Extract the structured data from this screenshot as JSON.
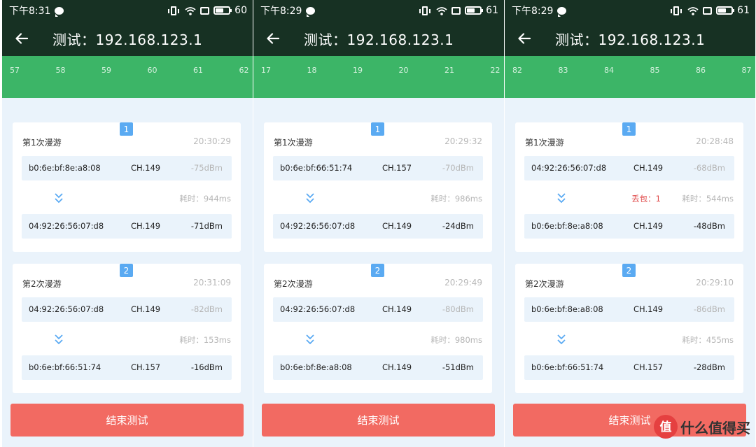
{
  "app": {
    "title": "测试：192.168.123.1",
    "end_button_label": "结束测试",
    "latency_prefix": "耗时：",
    "loss_prefix": "丢包："
  },
  "colors": {
    "appbar_bg": "#173123",
    "ruler_bg": "#3cb567",
    "page_bg": "#eaf3fb",
    "badge_bg": "#5aaaf2",
    "end_button_bg": "#f26a62",
    "loss_text": "#e04b4b"
  },
  "icons": {
    "back": "back-arrow-icon",
    "message": "chat-bubble-icon",
    "vibrate": "vibrate-icon",
    "wifi": "wifi-icon",
    "screen": "screen-icon",
    "battery": "battery-icon",
    "transition": "double-chevron-down-icon"
  },
  "screens": [
    {
      "status": {
        "time": "下午8:31",
        "battery": "60"
      },
      "ruler": [
        "57",
        "58",
        "59",
        "60",
        "61",
        "62"
      ],
      "roams": [
        {
          "badge": "1",
          "title": "第1次漫游",
          "time": "20:30:29",
          "from": {
            "mac": "b0:6e:bf:8e:a8:08",
            "channel": "CH.149",
            "signal": "-75dBm"
          },
          "loss": "",
          "latency": "944ms",
          "to": {
            "mac": "04:92:26:56:07:d8",
            "channel": "CH.149",
            "signal": "-71dBm"
          }
        },
        {
          "badge": "2",
          "title": "第2次漫游",
          "time": "20:31:09",
          "from": {
            "mac": "04:92:26:56:07:d8",
            "channel": "CH.149",
            "signal": "-82dBm"
          },
          "loss": "",
          "latency": "153ms",
          "to": {
            "mac": "b0:6e:bf:66:51:74",
            "channel": "CH.157",
            "signal": "-16dBm"
          }
        }
      ]
    },
    {
      "status": {
        "time": "下午8:29",
        "battery": "61"
      },
      "ruler": [
        "17",
        "18",
        "19",
        "20",
        "21",
        "22"
      ],
      "roams": [
        {
          "badge": "1",
          "title": "第1次漫游",
          "time": "20:29:32",
          "from": {
            "mac": "b0:6e:bf:66:51:74",
            "channel": "CH.157",
            "signal": "-70dBm"
          },
          "loss": "",
          "latency": "986ms",
          "to": {
            "mac": "04:92:26:56:07:d8",
            "channel": "CH.149",
            "signal": "-24dBm"
          }
        },
        {
          "badge": "2",
          "title": "第2次漫游",
          "time": "20:29:49",
          "from": {
            "mac": "04:92:26:56:07:d8",
            "channel": "CH.149",
            "signal": "-80dBm"
          },
          "loss": "",
          "latency": "980ms",
          "to": {
            "mac": "b0:6e:bf:8e:a8:08",
            "channel": "CH.149",
            "signal": "-51dBm"
          }
        }
      ]
    },
    {
      "status": {
        "time": "下午8:29",
        "battery": "61"
      },
      "ruler": [
        "82",
        "83",
        "84",
        "85",
        "86",
        "87"
      ],
      "roams": [
        {
          "badge": "1",
          "title": "第1次漫游",
          "time": "20:28:48",
          "from": {
            "mac": "04:92:26:56:07:d8",
            "channel": "CH.149",
            "signal": "-68dBm"
          },
          "loss": "1",
          "latency": "544ms",
          "to": {
            "mac": "b0:6e:bf:8e:a8:08",
            "channel": "CH.149",
            "signal": "-48dBm"
          }
        },
        {
          "badge": "2",
          "title": "第2次漫游",
          "time": "20:29:10",
          "from": {
            "mac": "b0:6e:bf:8e:a8:08",
            "channel": "CH.149",
            "signal": "-86dBm"
          },
          "loss": "",
          "latency": "455ms",
          "to": {
            "mac": "b0:6e:bf:66:51:74",
            "channel": "CH.157",
            "signal": "-28dBm"
          }
        }
      ]
    }
  ],
  "watermark": {
    "text": "什么值得买",
    "logo_glyph": "值"
  }
}
